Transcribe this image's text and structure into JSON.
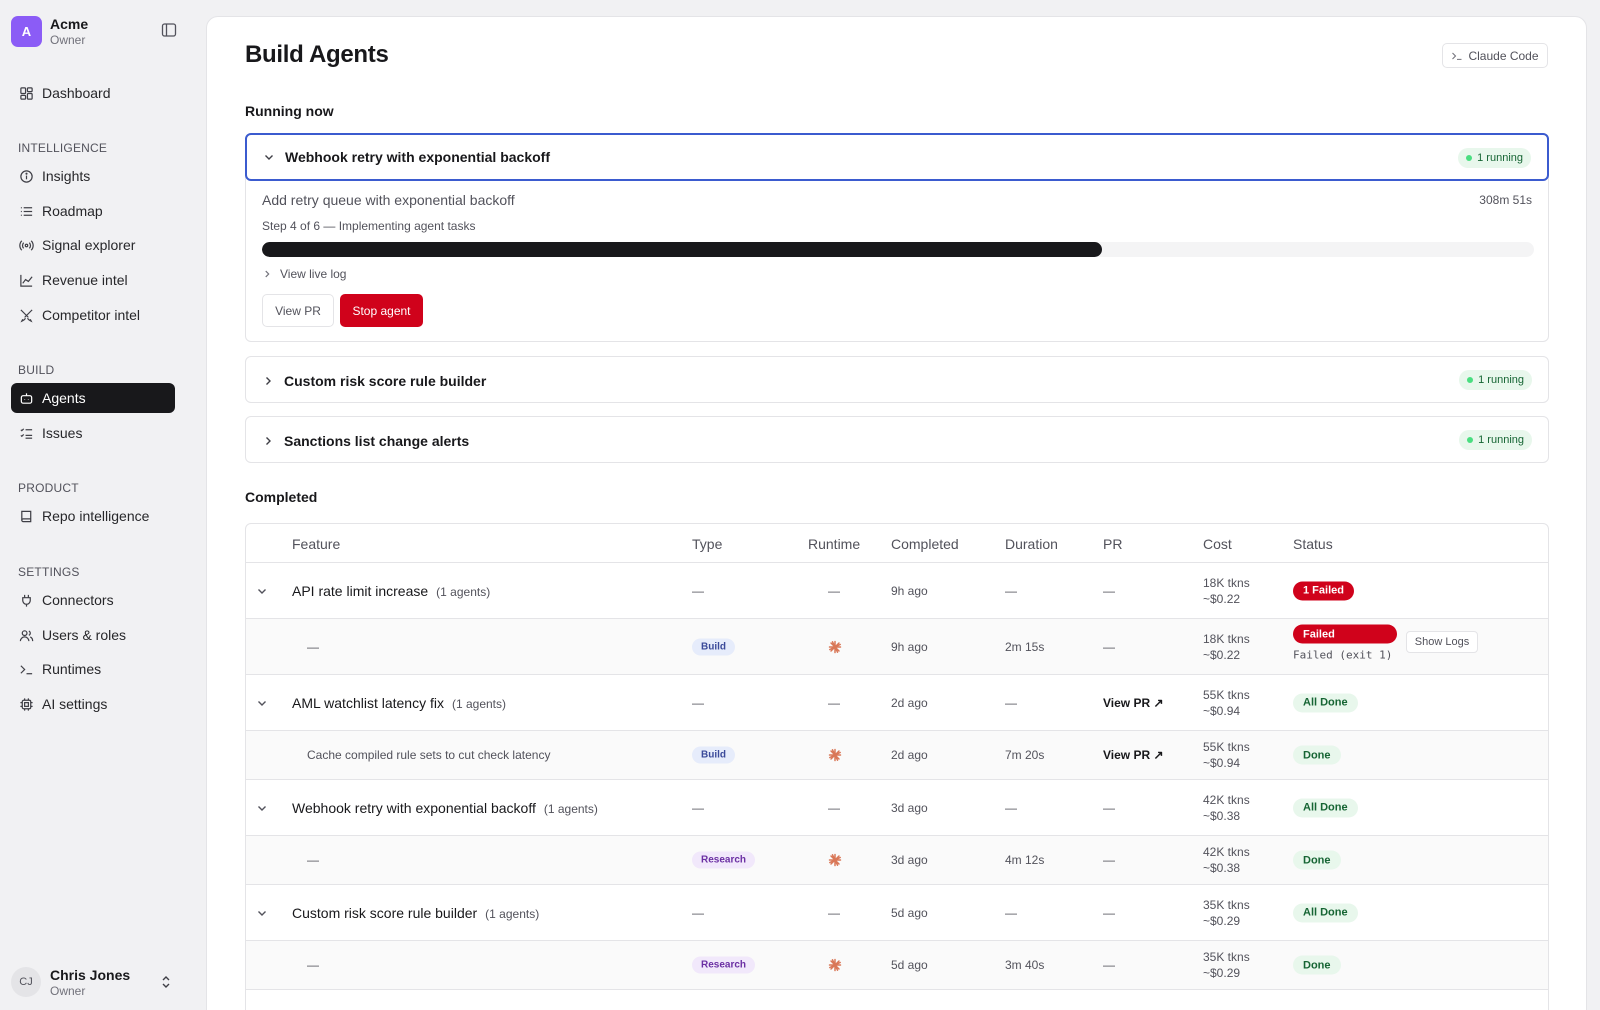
{
  "workspace": {
    "avatar": "A",
    "name": "Acme",
    "role": "Owner"
  },
  "nav": {
    "dashboard": "Dashboard",
    "sections": {
      "intelligence": "INTELLIGENCE",
      "build": "BUILD",
      "product": "PRODUCT",
      "settings": "SETTINGS"
    },
    "insights": "Insights",
    "roadmap": "Roadmap",
    "signal_explorer": "Signal explorer",
    "revenue_intel": "Revenue intel",
    "competitor_intel": "Competitor intel",
    "agents": "Agents",
    "issues": "Issues",
    "repo_intelligence": "Repo intelligence",
    "connectors": "Connectors",
    "users_roles": "Users & roles",
    "runtimes": "Runtimes",
    "ai_settings": "AI settings"
  },
  "user": {
    "initials": "CJ",
    "name": "Chris Jones",
    "role": "Owner"
  },
  "page": {
    "title": "Build Agents",
    "claude_code": "Claude Code"
  },
  "running": {
    "title": "Running now",
    "cards": [
      {
        "name": "Webhook retry with exponential backoff",
        "badge": "1 running",
        "task": "Add retry queue with exponential backoff",
        "elapsed": "308m 51s",
        "step": "Step 4 of 6 — Implementing agent tasks",
        "progress": 0.66,
        "live_log": "View live log",
        "view_pr": "View PR",
        "stop": "Stop agent"
      },
      {
        "name": "Custom risk score rule builder",
        "badge": "1 running"
      },
      {
        "name": "Sanctions list change alerts",
        "badge": "1 running"
      }
    ]
  },
  "completed": {
    "title": "Completed",
    "headers": {
      "feature": "Feature",
      "type": "Type",
      "runtime": "Runtime",
      "completed": "Completed",
      "duration": "Duration",
      "pr": "PR",
      "cost": "Cost",
      "status": "Status"
    },
    "rows": [
      {
        "feature": "API rate limit increase",
        "count": "(1 agents)",
        "type": "—",
        "runtime": "—",
        "completed": "9h ago",
        "duration": "—",
        "pr": "—",
        "cost1": "18K tkns",
        "cost2": "~$0.22",
        "status": "1 Failed"
      },
      {
        "feature": "—",
        "type": "Build",
        "completed": "9h ago",
        "duration": "2m 15s",
        "pr": "—",
        "cost1": "18K tkns",
        "cost2": "~$0.22",
        "status": "Failed",
        "note": "Failed (exit 1)",
        "logs": "Show Logs"
      },
      {
        "feature": "AML watchlist latency fix",
        "count": "(1 agents)",
        "type": "—",
        "runtime": "—",
        "completed": "2d ago",
        "duration": "—",
        "pr": "View PR ↗",
        "cost1": "55K tkns",
        "cost2": "~$0.94",
        "status": "All Done"
      },
      {
        "feature": "Cache compiled rule sets to cut check latency",
        "type": "Build",
        "completed": "2d ago",
        "duration": "7m 20s",
        "pr": "View PR ↗",
        "cost1": "55K tkns",
        "cost2": "~$0.94",
        "status": "Done"
      },
      {
        "feature": "Webhook retry with exponential backoff",
        "count": "(1 agents)",
        "type": "—",
        "runtime": "—",
        "completed": "3d ago",
        "duration": "—",
        "pr": "—",
        "cost1": "42K tkns",
        "cost2": "~$0.38",
        "status": "All Done"
      },
      {
        "feature": "—",
        "type": "Research",
        "completed": "3d ago",
        "duration": "4m 12s",
        "pr": "—",
        "cost1": "42K tkns",
        "cost2": "~$0.38",
        "status": "Done"
      },
      {
        "feature": "Custom risk score rule builder",
        "count": "(1 agents)",
        "type": "—",
        "runtime": "—",
        "completed": "5d ago",
        "duration": "—",
        "pr": "—",
        "cost1": "35K tkns",
        "cost2": "~$0.29",
        "status": "All Done"
      },
      {
        "feature": "—",
        "type": "Research",
        "completed": "5d ago",
        "duration": "3m 40s",
        "pr": "—",
        "cost1": "35K tkns",
        "cost2": "~$0.29",
        "status": "Done"
      }
    ]
  },
  "colors": {
    "accent": "#18181b",
    "danger": "#d0021b",
    "success_bg": "#e8f7ec",
    "focus": "#3b5bcf"
  }
}
